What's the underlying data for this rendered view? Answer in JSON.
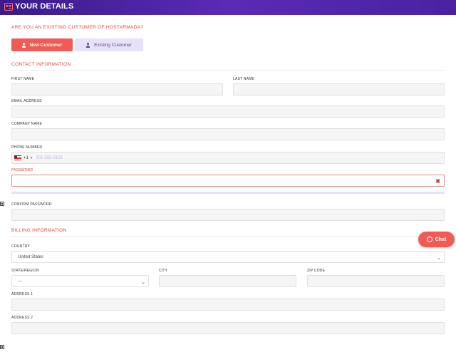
{
  "header": {
    "title": "YOUR DETAILS"
  },
  "question": "ARE YOU AN EXISTING CUSTOMER OF HOSTARMADA?",
  "buttons": {
    "new_customer": "New Customer",
    "existing_customer": "Existing Customer"
  },
  "contact": {
    "title": "CONTACT INFORMATION",
    "first_name_label": "FIRST NAME",
    "last_name_label": "LAST NAME",
    "email_label": "EMAIL ADDRESS",
    "company_label": "COMPANY NAME",
    "phone_label": "PHONE NUMBER",
    "phone_code": "+1",
    "phone_placeholder": "201-555-0123",
    "password_label": "PASSWORD",
    "confirm_password_label": "CONFIRM PASSWORD"
  },
  "billing": {
    "title": "BILLING INFORMATION",
    "country_label": "COUNTRY",
    "country_value": "United States",
    "state_label": "STATE/REGION",
    "state_value": "---",
    "city_label": "CITY",
    "zip_label": "ZIP CODE",
    "address1_label": "ADDRESS 1",
    "address2_label": "ADDRESS 2"
  },
  "chat": {
    "label": "Chat"
  },
  "colors": {
    "accent": "#f15b54",
    "header": "#4a22a0",
    "section": "#e2443d",
    "secondary_button": "#e8e1fb"
  }
}
